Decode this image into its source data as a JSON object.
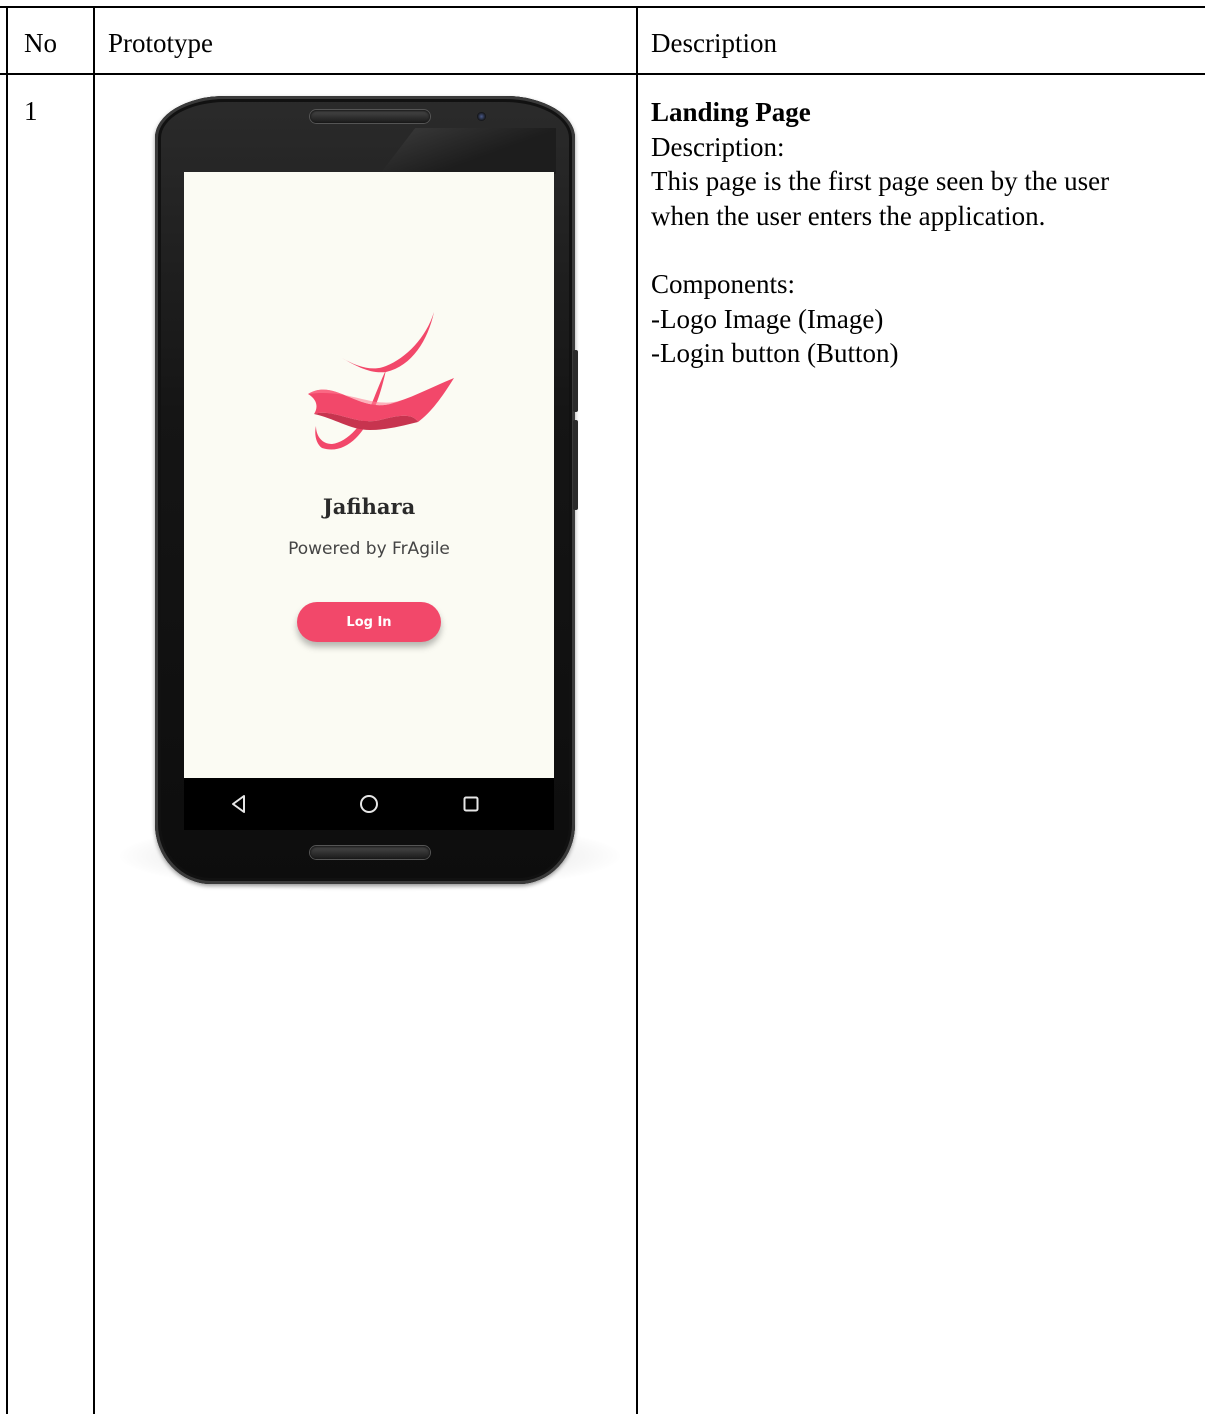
{
  "table": {
    "headers": {
      "no": "No",
      "prototype": "Prototype",
      "description": "Description"
    },
    "rows": [
      {
        "no": "1",
        "description": {
          "title": "Landing Page",
          "label": "Description:",
          "text_line1": "This page is the first page seen by the user",
          "text_line2": "when the user enters the application.",
          "components_label": "Components:",
          "components": [
            "-Logo Image (Image)",
            "-Login button (Button)"
          ]
        },
        "prototype": {
          "app_name": "Jafihara",
          "tagline": "Powered by FrAgile",
          "login_label": "Log In",
          "accent_color": "#f2486a",
          "background_color": "#fbfbf3",
          "nav_icons": [
            "back-triangle-icon",
            "home-circle-icon",
            "recents-square-icon"
          ]
        }
      }
    ]
  }
}
